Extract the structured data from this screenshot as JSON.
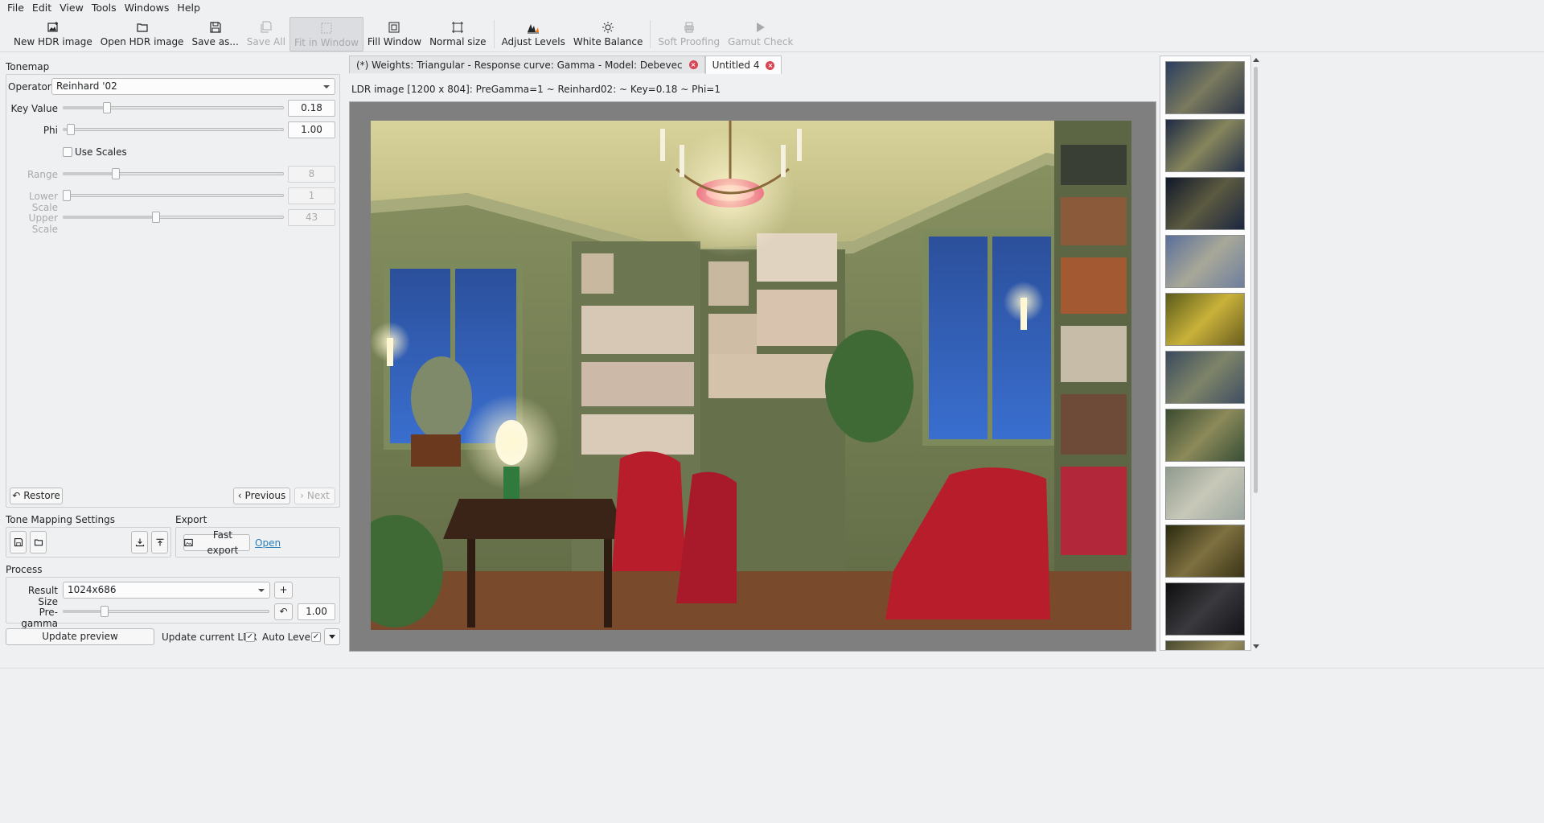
{
  "menu": [
    "File",
    "Edit",
    "View",
    "Tools",
    "Windows",
    "Help"
  ],
  "toolbar": {
    "new_hdr": "New HDR image",
    "open_hdr": "Open HDR image",
    "save_as": "Save as...",
    "save_all": "Save All",
    "fit_window": "Fit in Window",
    "fill_window": "Fill Window",
    "normal_size": "Normal size",
    "adjust_levels": "Adjust Levels",
    "white_balance": "White Balance",
    "soft_proofing": "Soft Proofing",
    "gamut_check": "Gamut Check"
  },
  "tonemap": {
    "title": "Tonemap",
    "operator_label": "Operator",
    "operator_value": "Reinhard '02",
    "key_value_label": "Key Value",
    "key_value": "0.18",
    "key_value_level": 0.19,
    "phi_label": "Phi",
    "phi": "1.00",
    "phi_level": 0.02,
    "use_scales_label": "Use Scales",
    "range_label": "Range",
    "range": "8",
    "range_level": 0.23,
    "lower_scale_label": "Lower Scale",
    "lower_scale": "1",
    "lower_scale_level": 0.0,
    "upper_scale_label": "Upper Scale",
    "upper_scale": "43",
    "upper_scale_level": 0.42,
    "restore": "Restore",
    "previous": "Previous",
    "next": "Next"
  },
  "settings": {
    "title": "Tone Mapping Settings",
    "export_title": "Export",
    "fast_export": "Fast export",
    "open": "Open"
  },
  "process": {
    "title": "Process",
    "result_size_label": "Result Size",
    "result_size_value": "1024x686",
    "pregamma_label": "Pre-gamma",
    "pregamma": "1.00",
    "pregamma_level": 0.19,
    "update_preview": "Update preview",
    "update_current_ldr": "Update current LDR",
    "auto_levels": "Auto Levels"
  },
  "tabs": [
    {
      "label": "(*) Weights: Triangular - Response curve: Gamma - Model: Debevec"
    },
    {
      "label": "Untitled 4"
    }
  ],
  "viewer": {
    "info": "LDR image [1200 x 804]: PreGamma=1 ~ Reinhard02: ~ Key=0.18 ~ Phi=1"
  }
}
